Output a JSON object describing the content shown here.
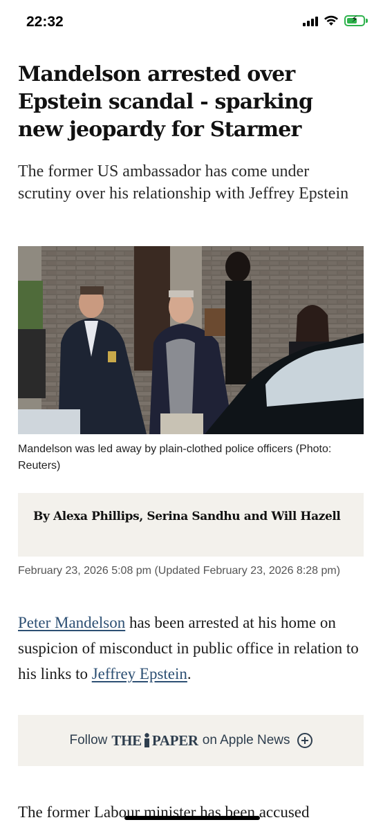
{
  "status_bar": {
    "time": "22:32"
  },
  "article": {
    "headline": "Mandelson arrested over Epstein scandal - sparking new jeopardy for Starmer",
    "standfirst": "The former US ambassador has come under scrutiny over his relationship with Jeffrey Epstein",
    "caption": "Mandelson was led away by plain-clothed police officers (Photo: Reuters)",
    "byline": "By Alexa Phillips, Serina Sandhu and Will Hazell",
    "dateline": "February 23, 2026 5:08 pm (Updated February 23, 2026 8:28 pm)",
    "body_1": {
      "link_1": "Peter Mandelson",
      "text_1": " has been arrested at his home on suspicion of misconduct in public office in relation to his links to ",
      "link_2": "Jeffrey Epstein",
      "text_2": "."
    },
    "follow": {
      "prefix": "Follow",
      "brand_the": "THE",
      "brand_paper": "PAPER",
      "suffix": "on Apple News"
    },
    "body_2": "The former Labour minister has been accused"
  },
  "colors": {
    "link": "#2c4f73",
    "box_bg": "#f3f1ec",
    "battery": "#2fb34d"
  }
}
